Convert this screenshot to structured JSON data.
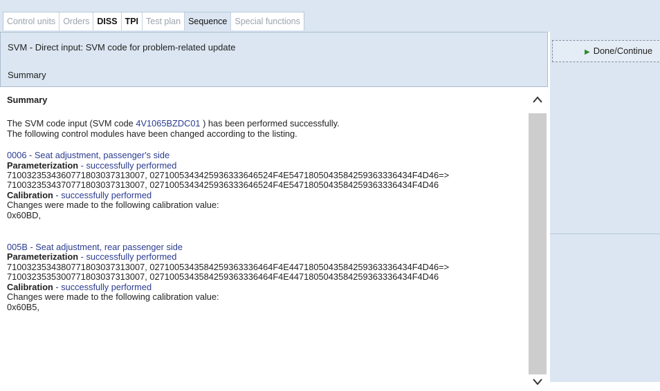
{
  "tabs": [
    {
      "label": "Control units",
      "style": "muted"
    },
    {
      "label": "Orders",
      "style": "muted"
    },
    {
      "label": "DISS",
      "style": "bold"
    },
    {
      "label": "TPI",
      "style": "bold"
    },
    {
      "label": "Test plan",
      "style": "muted"
    },
    {
      "label": "Sequence",
      "style": "active"
    },
    {
      "label": "Special functions",
      "style": "muted"
    }
  ],
  "header": {
    "title": "SVM - Direct input: SVM code for problem-related update",
    "subtitle": "Summary"
  },
  "done_button": {
    "label": "Done/Continue"
  },
  "summary": {
    "heading": "Summary",
    "intro_prefix": "The SVM code input (SVM code ",
    "svm_code": "4V1065BZDC01",
    "intro_suffix": " ) has been performed successfully.",
    "intro_line2": "The following control modules have been changed according to the listing."
  },
  "modules": [
    {
      "title": "0006 - Seat adjustment, passenger's side",
      "param_label": "Parameterization",
      "param_status": " - successfully performed",
      "param_line1": "7100323534360771803037313007, 0271005343425936333646524F4E5471805043584259363336434F4D46=>",
      "param_line2": "7100323534370771803037313007, 0271005343425936333646524F4E5471805043584259363336434F4D46",
      "calib_label": "Calibration",
      "calib_status": " - successfully performed",
      "calib_text": "Changes were made to the following calibration value:",
      "calib_value": "0x60BD,"
    },
    {
      "title": "005B - Seat adjustment, rear passenger side",
      "param_label": "Parameterization",
      "param_status": " - successfully performed",
      "param_line1": "7100323534380771803037313007, 0271005343584259363336464F4E4471805043584259363336434F4D46=>",
      "param_line2": "7100323535300771803037313007, 0271005343584259363336464F4E4471805043584259363336434F4D46",
      "calib_label": "Calibration",
      "calib_status": " - successfully performed",
      "calib_text": "Changes were made to the following calibration value:",
      "calib_value": "0x60B5,"
    }
  ],
  "icons": {
    "scroll_up": "chevron-up-icon",
    "scroll_down": "chevron-down-icon",
    "play": "play-icon"
  },
  "colors": {
    "panel": "#dbe6f2",
    "link": "#2a3b8f",
    "play": "#2e8b2e"
  }
}
